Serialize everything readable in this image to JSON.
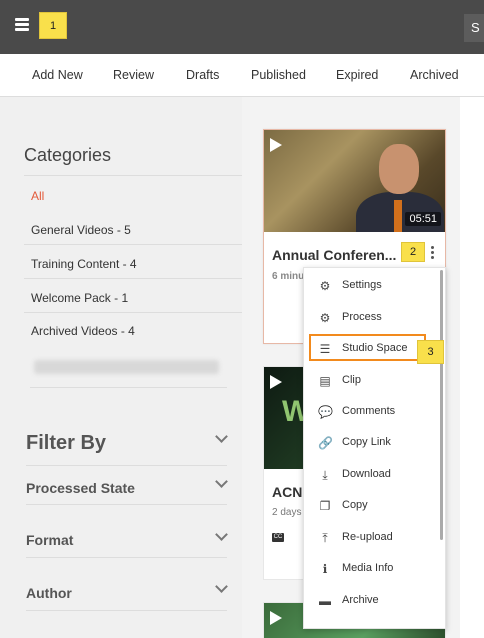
{
  "header": {
    "menu_icon": "hamburger-icon",
    "callout_1": "1",
    "search_stub": "S"
  },
  "tabs": [
    "Add New",
    "Review",
    "Drafts",
    "Published",
    "Expired",
    "Archived"
  ],
  "sidebar": {
    "categories_title": "Categories",
    "categories": [
      {
        "label": "All",
        "active": true
      },
      {
        "label": "General Videos - 5"
      },
      {
        "label": "Training Content - 4"
      },
      {
        "label": "Welcome Pack - 1"
      },
      {
        "label": "Archived Videos - 4"
      }
    ],
    "filter_title": "Filter By",
    "filters": [
      "Processed State",
      "Format",
      "Author"
    ]
  },
  "cards": [
    {
      "title": "Annual Conferen...",
      "subtitle": "6 minu",
      "duration": "05:51"
    },
    {
      "title": "ACN",
      "subtitle": "2 days",
      "thumb_text": "W",
      "cc": "CC"
    }
  ],
  "callouts": {
    "two": "2",
    "three": "3"
  },
  "menu": {
    "items": [
      {
        "icon": "gear-icon",
        "glyph": "⚙",
        "label": "Settings"
      },
      {
        "icon": "process-icon",
        "glyph": "⚙",
        "label": "Process"
      },
      {
        "icon": "sliders-icon",
        "glyph": "☰",
        "label": "Studio Space"
      },
      {
        "icon": "film-icon",
        "glyph": "▤",
        "label": "Clip"
      },
      {
        "icon": "comments-icon",
        "glyph": "💬",
        "label": "Comments"
      },
      {
        "icon": "link-icon",
        "glyph": "🔗",
        "label": "Copy Link"
      },
      {
        "icon": "download-icon",
        "glyph": "⤓",
        "label": "Download"
      },
      {
        "icon": "copy-icon",
        "glyph": "❐",
        "label": "Copy"
      },
      {
        "icon": "upload-icon",
        "glyph": "⤒",
        "label": "Re-upload"
      },
      {
        "icon": "info-icon",
        "glyph": "ℹ",
        "label": "Media Info"
      },
      {
        "icon": "archive-icon",
        "glyph": "▬",
        "label": "Archive"
      }
    ]
  },
  "colors": {
    "topbar": "#4a4a4a",
    "accent": "#e35a3a",
    "callout": "#f9e04b",
    "highlight": "#f28a1d"
  }
}
